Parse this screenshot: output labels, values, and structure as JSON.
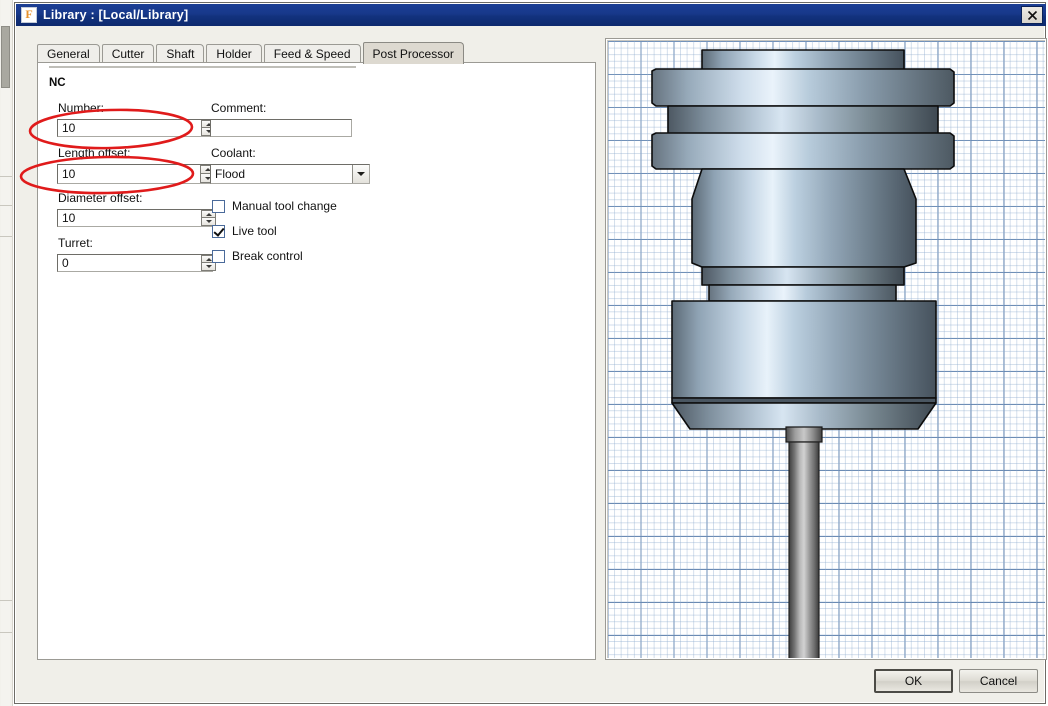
{
  "window": {
    "title": "Library :  [Local/Library]",
    "icon": "app-f-icon",
    "close_label": "×"
  },
  "tabs": [
    {
      "label": "General",
      "selected": false
    },
    {
      "label": "Cutter",
      "selected": false
    },
    {
      "label": "Shaft",
      "selected": false
    },
    {
      "label": "Holder",
      "selected": false
    },
    {
      "label": "Feed & Speed",
      "selected": false
    },
    {
      "label": "Post Processor",
      "selected": true
    }
  ],
  "post_processor": {
    "group_title": "NC",
    "fields": {
      "number": {
        "label": "Number:",
        "value": "10"
      },
      "comment": {
        "label": "Comment:",
        "value": "",
        "placeholder": ""
      },
      "length_offset": {
        "label": "Length offset:",
        "value": "10"
      },
      "coolant": {
        "label": "Coolant:",
        "value": "Flood"
      },
      "diameter_offset": {
        "label": "Diameter offset:",
        "value": "10"
      },
      "turret": {
        "label": "Turret:",
        "value": "0"
      }
    },
    "checkboxes": [
      {
        "label": "Manual tool change",
        "checked": false
      },
      {
        "label": "Live tool",
        "checked": true
      },
      {
        "label": "Break control",
        "checked": false
      }
    ]
  },
  "annotations": {
    "color": "#e01b1b",
    "shapes": [
      {
        "name": "number-field-highlight",
        "note": "red ellipse around Number field"
      },
      {
        "name": "length-offset-field-highlight",
        "note": "red ellipse around Length offset field"
      }
    ]
  },
  "preview": {
    "name": "tool-3d-preview",
    "grid": true
  },
  "footer": {
    "ok_label": "OK",
    "cancel_label": "Cancel"
  },
  "colors": {
    "titlebar": "#173a8f",
    "accent_red": "#e01b1b",
    "dialog_face": "#f0efe9",
    "grid_minor": "#8caacd",
    "grid_major": "#486ea0"
  }
}
